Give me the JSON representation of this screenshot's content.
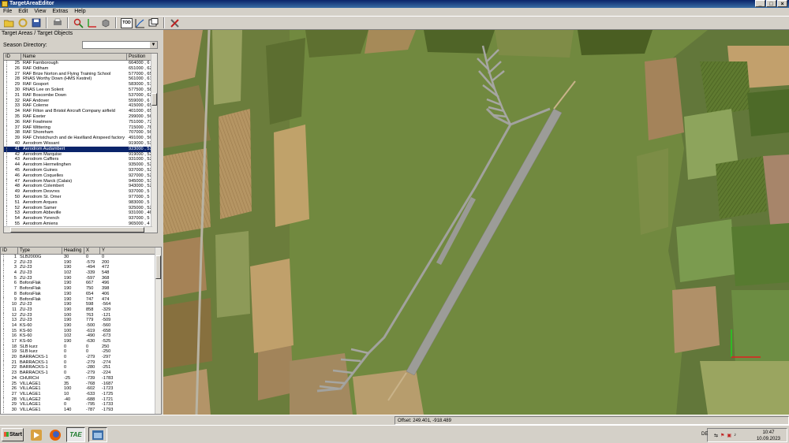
{
  "window": {
    "title": "TargetAreaEditor"
  },
  "menu": [
    "File",
    "Edit",
    "View",
    "Extras",
    "Help"
  ],
  "toolbar": {
    "icons": [
      "open-folder-icon",
      "refresh-icon",
      "save-icon",
      "print-icon",
      "search-icon",
      "axis-icon",
      "cube-icon",
      "tod-icon",
      "graph-icon",
      "window-icon",
      "tools-icon"
    ],
    "tod_label": "TOD"
  },
  "left_panel": {
    "section_label": "Target Areas / Target Objects",
    "season_label": "Season Directory:",
    "season_value": ""
  },
  "areas_table": {
    "headers": [
      "ID",
      "Name",
      "Position"
    ],
    "selected_index": 16,
    "rows": [
      {
        "id": "25",
        "name": "RAF Farnborough",
        "pos": "664000 , 6"
      },
      {
        "id": "26",
        "name": "RAF Odiham",
        "pos": "651000 , 62"
      },
      {
        "id": "27",
        "name": "RAF Brize Norton and Flying Training School",
        "pos": "577000 , 65"
      },
      {
        "id": "28",
        "name": "RNAS Worthy Down (HMS Kestrel)",
        "pos": "561000 , 61"
      },
      {
        "id": "29",
        "name": "RAF Gosport",
        "pos": "583000 , 57"
      },
      {
        "id": "30",
        "name": "RNAS Lee on Solent",
        "pos": "577500 , 58"
      },
      {
        "id": "31",
        "name": "RAF Boscombe Down",
        "pos": "537000 , 62"
      },
      {
        "id": "32",
        "name": "RAF Andover",
        "pos": "559000 , 6"
      },
      {
        "id": "33",
        "name": "RAF Colerne",
        "pos": "415000 , 65"
      },
      {
        "id": "34",
        "name": "RAF Filton and Bristol Aircraft Company airfield",
        "pos": "401000 , 65"
      },
      {
        "id": "35",
        "name": "RAF Exeter",
        "pos": "299000 , 56"
      },
      {
        "id": "36",
        "name": "RAF Fowlmere",
        "pos": "751000 , 72"
      },
      {
        "id": "37",
        "name": "RAF Wittering",
        "pos": "715000 , 78"
      },
      {
        "id": "38",
        "name": "RAF Shoreham",
        "pos": "707000 , 56"
      },
      {
        "id": "39",
        "name": "RAF Christchurch and de Havilland Airspeed factory",
        "pos": "491000 , 56"
      },
      {
        "id": "40",
        "name": "Aerodrom Wissant",
        "pos": "919000 , 53"
      },
      {
        "id": "41",
        "name": "Aerodrom Audambert",
        "pos": "923000 , 53"
      },
      {
        "id": "42",
        "name": "Aerodrom Marquise",
        "pos": "919000 , 52"
      },
      {
        "id": "43",
        "name": "Aerodrom Caffiers",
        "pos": "931000 , 52"
      },
      {
        "id": "44",
        "name": "Aerodrom Hermelinghen",
        "pos": "935000 , 52"
      },
      {
        "id": "45",
        "name": "Aerodrom Guines",
        "pos": "937000 , 52"
      },
      {
        "id": "46",
        "name": "Aerodrom Coquelles",
        "pos": "927000 , 52"
      },
      {
        "id": "47",
        "name": "Aerodrom Marck (Calais)",
        "pos": "945000 , 53"
      },
      {
        "id": "48",
        "name": "Aerodrom Colembert",
        "pos": "943000 , 52"
      },
      {
        "id": "49",
        "name": "Aerodrom Desvres",
        "pos": "937000 , 5"
      },
      {
        "id": "50",
        "name": "Aerodrom St. Omer",
        "pos": "977000 , 5"
      },
      {
        "id": "51",
        "name": "Aerodrom Arques",
        "pos": "983000 , 5"
      },
      {
        "id": "52",
        "name": "Aerodrom Samer",
        "pos": "925000 , 52"
      },
      {
        "id": "53",
        "name": "Aerodrom Abbeville",
        "pos": "931000 , 46"
      },
      {
        "id": "54",
        "name": "Aerodrom Yvrench",
        "pos": "937000 , 5"
      },
      {
        "id": "55",
        "name": "Aerodrom Amiens",
        "pos": "965000 , 4"
      },
      {
        "id": "56",
        "name": "Aerodrom Beauvais",
        "pos": "973000 , 4"
      }
    ]
  },
  "objects_table": {
    "headers": [
      "ID",
      "Type",
      "Heading",
      "X",
      "Y"
    ],
    "rows": [
      {
        "id": "1",
        "type": "SLB2000G",
        "heading": "30",
        "x": "0",
        "y": "0"
      },
      {
        "id": "2",
        "type": "ZU-23",
        "heading": "190",
        "x": "-579",
        "y": "200"
      },
      {
        "id": "3",
        "type": "ZU-23",
        "heading": "190",
        "x": "-494",
        "y": "472"
      },
      {
        "id": "4",
        "type": "ZU-23",
        "heading": "102",
        "x": "-339",
        "y": "548"
      },
      {
        "id": "5",
        "type": "ZU-23",
        "heading": "190",
        "x": "-597",
        "y": "368"
      },
      {
        "id": "6",
        "type": "BoforsFlak",
        "heading": "190",
        "x": "667",
        "y": "496"
      },
      {
        "id": "7",
        "type": "BoforsFlak",
        "heading": "190",
        "x": "750",
        "y": "398"
      },
      {
        "id": "8",
        "type": "BoforsFlak",
        "heading": "190",
        "x": "654",
        "y": "406"
      },
      {
        "id": "9",
        "type": "BoforsFlak",
        "heading": "190",
        "x": "747",
        "y": "474"
      },
      {
        "id": "10",
        "type": "ZU-23",
        "heading": "190",
        "x": "598",
        "y": "-564"
      },
      {
        "id": "11",
        "type": "ZU-23",
        "heading": "190",
        "x": "858",
        "y": "-329"
      },
      {
        "id": "12",
        "type": "ZU-23",
        "heading": "100",
        "x": "763",
        "y": "-121"
      },
      {
        "id": "13",
        "type": "ZU-23",
        "heading": "190",
        "x": "779",
        "y": "-509"
      },
      {
        "id": "14",
        "type": "KS-60",
        "heading": "190",
        "x": "-500",
        "y": "-560"
      },
      {
        "id": "15",
        "type": "KS-60",
        "heading": "100",
        "x": "-619",
        "y": "-658"
      },
      {
        "id": "16",
        "type": "KS-60",
        "heading": "102",
        "x": "-490",
        "y": "-673"
      },
      {
        "id": "17",
        "type": "KS-60",
        "heading": "190",
        "x": "-630",
        "y": "-525"
      },
      {
        "id": "18",
        "type": "SLB kurz",
        "heading": "0",
        "x": "0",
        "y": "250"
      },
      {
        "id": "19",
        "type": "SLB kurz",
        "heading": "0",
        "x": "0",
        "y": "-250"
      },
      {
        "id": "20",
        "type": "BARRACKS-1",
        "heading": "0",
        "x": "-279",
        "y": "-297"
      },
      {
        "id": "21",
        "type": "BARRACKS-1",
        "heading": "0",
        "x": "-279",
        "y": "-274"
      },
      {
        "id": "22",
        "type": "BARRACKS-1",
        "heading": "0",
        "x": "-280",
        "y": "-251"
      },
      {
        "id": "23",
        "type": "BARRACKS-1",
        "heading": "0",
        "x": "-279",
        "y": "-224"
      },
      {
        "id": "24",
        "type": "CHURCH",
        "heading": "-25",
        "x": "-739",
        "y": "-1783"
      },
      {
        "id": "25",
        "type": "VILLAGE1",
        "heading": "35",
        "x": "-768",
        "y": "-1687"
      },
      {
        "id": "26",
        "type": "VILLAGE1",
        "heading": "100",
        "x": "-602",
        "y": "-1723"
      },
      {
        "id": "27",
        "type": "VILLAGE1",
        "heading": "10",
        "x": "-633",
        "y": "-1725"
      },
      {
        "id": "28",
        "type": "VILLAGE2",
        "heading": "-40",
        "x": "-688",
        "y": "-1721"
      },
      {
        "id": "29",
        "type": "VILLAGE1",
        "heading": "0",
        "x": "-795",
        "y": "-1733"
      },
      {
        "id": "30",
        "type": "VILLAGE1",
        "heading": "140",
        "x": "-787",
        "y": "-1793"
      }
    ]
  },
  "statusbar": {
    "offset": "Offset: 249.401, -918.489"
  },
  "taskbar": {
    "start_label": "Start",
    "tae_label": "TAE",
    "lang": "DE",
    "time": "10:47",
    "date": "10.09.2023"
  }
}
